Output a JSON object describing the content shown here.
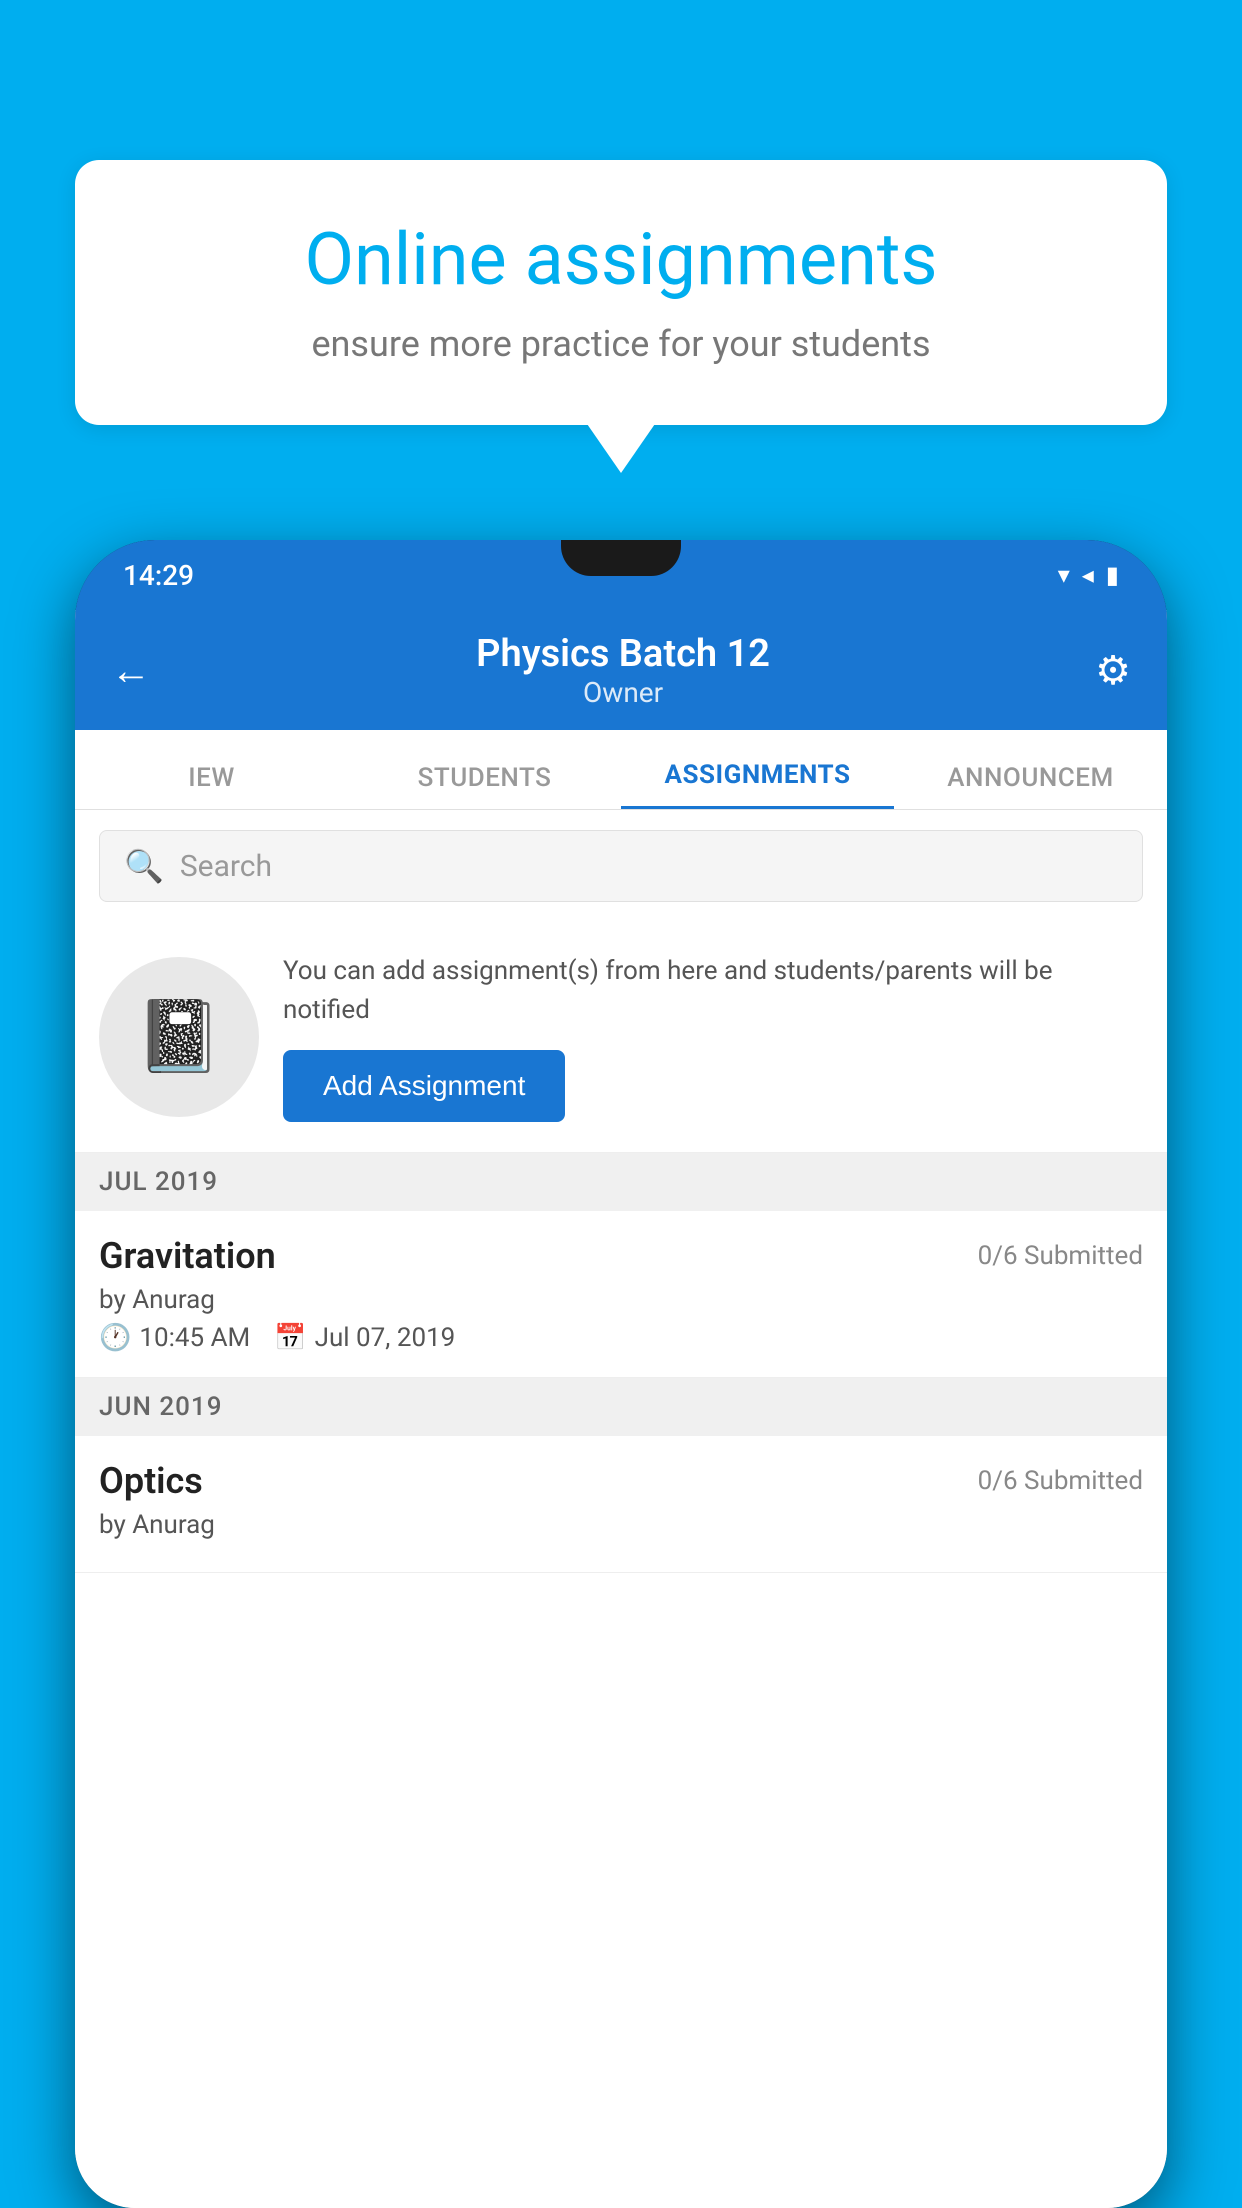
{
  "background": {
    "color": "#00AEEF"
  },
  "speech_bubble": {
    "title": "Online assignments",
    "subtitle": "ensure more practice for your students"
  },
  "phone": {
    "status_bar": {
      "time": "14:29",
      "signal_icons": "▾◂▮"
    },
    "header": {
      "title": "Physics Batch 12",
      "subtitle": "Owner",
      "back_label": "←",
      "settings_label": "⚙"
    },
    "tabs": [
      {
        "label": "IEW",
        "active": false
      },
      {
        "label": "STUDENTS",
        "active": false
      },
      {
        "label": "ASSIGNMENTS",
        "active": true
      },
      {
        "label": "ANNOUNCEM",
        "active": false
      }
    ],
    "search": {
      "placeholder": "Search"
    },
    "promo": {
      "description": "You can add assignment(s) from here and students/parents will be notified",
      "button_label": "Add Assignment"
    },
    "assignment_groups": [
      {
        "month": "JUL 2019",
        "assignments": [
          {
            "title": "Gravitation",
            "submitted": "0/6 Submitted",
            "by": "by Anurag",
            "time": "10:45 AM",
            "date": "Jul 07, 2019"
          }
        ]
      },
      {
        "month": "JUN 2019",
        "assignments": [
          {
            "title": "Optics",
            "submitted": "0/6 Submitted",
            "by": "by Anurag",
            "time": "",
            "date": ""
          }
        ]
      }
    ]
  }
}
